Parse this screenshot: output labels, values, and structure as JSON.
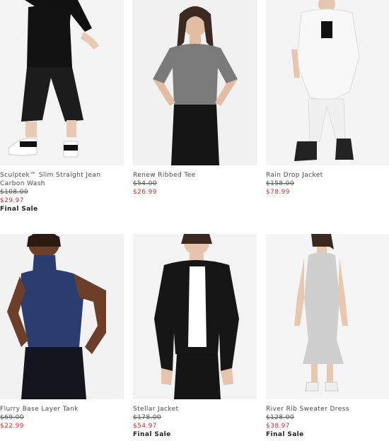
{
  "products": [
    {
      "name": "Sculptek™ Slim Straight Jean Carbon Wash",
      "original_price": "$108.00",
      "sale_price": "$29.97",
      "badge": "Final Sale",
      "colors": {
        "top": "#111111",
        "bottom": "#1c1c1c",
        "skin": "#e8c9b4"
      }
    },
    {
      "name": "Renew Ribbed Tee",
      "original_price": "$54.00",
      "sale_price": "$26.99",
      "badge": "",
      "colors": {
        "top": "#7a7a7a",
        "bottom": "#151515",
        "skin": "#e2bda3"
      }
    },
    {
      "name": "Rain Drop Jacket",
      "original_price": "$158.00",
      "sale_price": "$78.99",
      "badge": "",
      "colors": {
        "top": "#f7f7f7",
        "bottom": "#efefef",
        "skin": "#e8c6ae"
      }
    },
    {
      "name": "Flurry Base Layer Tank",
      "original_price": "$69.00",
      "sale_price": "$22.99",
      "badge": "",
      "colors": {
        "top": "#2a3d6e",
        "bottom": "#151520",
        "skin": "#6b3f2a"
      }
    },
    {
      "name": "Stellar Jacket",
      "original_price": "$178.00",
      "sale_price": "$54.97",
      "badge": "Final Sale",
      "colors": {
        "top": "#161616",
        "bottom": "#151515",
        "skin": "#e6c3aa"
      }
    },
    {
      "name": "River Rib Sweater Dress",
      "original_price": "$128.00",
      "sale_price": "$38.97",
      "badge": "Final Sale",
      "colors": {
        "top": "#cfcfcf",
        "bottom": "#cfcfcf",
        "skin": "#e8c8b0"
      }
    }
  ]
}
